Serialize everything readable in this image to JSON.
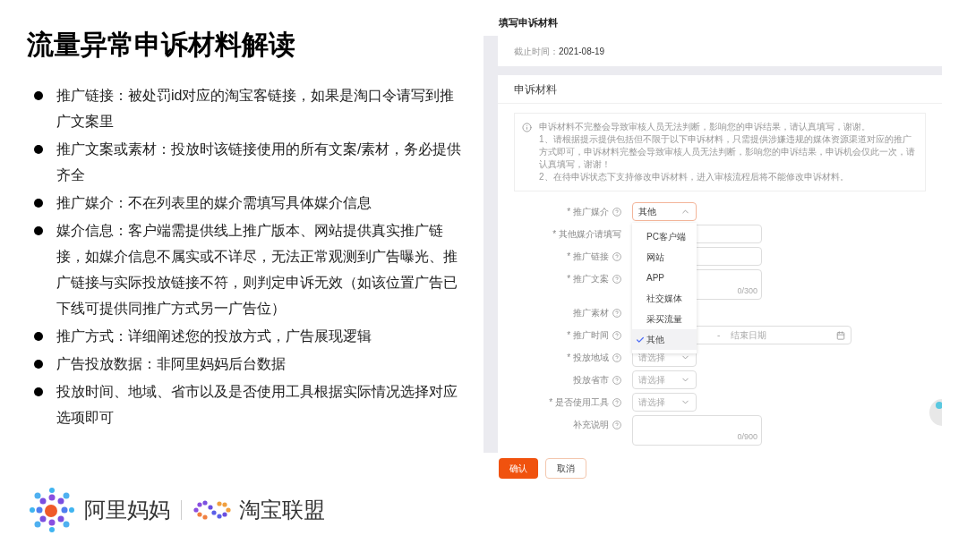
{
  "slide": {
    "title": "流量异常申诉材料解读",
    "bullets": [
      "推广链接：被处罚id对应的淘宝客链接，如果是淘口令请写到推广文案里",
      "推广文案或素材：投放时该链接使用的所有文案/素材，务必提供齐全",
      "推广媒介：不在列表里的媒介需填写具体媒介信息",
      "媒介信息：客户端需提供线上推广版本、网站提供真实推广链接，如媒介信息不属实或不详尽，无法正常观测到广告曝光、推广链接与实际投放链接不符，则判定申诉无效（如该位置广告已下线可提供同推广方式另一广告位）",
      "推广方式：详细阐述您的投放方式，广告展现逻辑",
      "广告投放数据：非阿里妈妈后台数据",
      "投放时间、地域、省市以及是否使用工具根据实际情况选择对应选项即可"
    ],
    "logos": [
      "阿里妈妈",
      "淘宝联盟"
    ]
  },
  "form_page": {
    "title": "填写申诉材料",
    "deadline": {
      "label": "截止时间：",
      "value": "2021-08-19"
    },
    "section_title": "申诉材料",
    "notice": [
      "申诉材料不完整会导致审核人员无法判断，影响您的申诉结果，请认真填写，谢谢。",
      "1、请根据提示提供包括但不限于以下申诉材料，只需提供涉嫌违规的媒体资源渠道对应的推广方式即可，申诉材料完整会导致审核人员无法判断，影响您的申诉结果，申诉机会仅此一次，请认真填写，谢谢！",
      "2、在待申诉状态下支持修改申诉材料，进入审核流程后将不能修改申诉材料。"
    ],
    "fields": [
      {
        "kind": "select",
        "label": "* 推广媒介",
        "help": true,
        "value": "其他",
        "expanded": true,
        "options": [
          {
            "label": "PC客户端",
            "selected": false
          },
          {
            "label": "网站",
            "selected": false
          },
          {
            "label": "APP",
            "selected": false
          },
          {
            "label": "社交媒体",
            "selected": false
          },
          {
            "label": "采买流量",
            "selected": false
          },
          {
            "label": "其他",
            "selected": true
          }
        ]
      },
      {
        "kind": "input",
        "label": "* 其他媒介请填写",
        "help": false
      },
      {
        "kind": "input",
        "label": "* 推广链接",
        "help": true
      },
      {
        "kind": "textarea",
        "label": "* 推广文案",
        "help": true,
        "counter": "0/300"
      },
      {
        "kind": "label",
        "label": "推广素材",
        "help": true
      },
      {
        "kind": "daterange",
        "label": "* 推广时间",
        "help": true,
        "separator": "-",
        "end_placeholder": "结束日期"
      },
      {
        "kind": "select",
        "label": "* 投放地域",
        "help": true,
        "placeholder": "请选择",
        "expanded": false
      },
      {
        "kind": "select",
        "label": "投放省市",
        "help": true,
        "placeholder": "请选择",
        "expanded": false
      },
      {
        "kind": "select",
        "label": "* 是否使用工具",
        "help": true,
        "placeholder": "请选择",
        "expanded": false
      },
      {
        "kind": "textarea",
        "label": "补充说明",
        "help": true,
        "counter": "0/900"
      }
    ],
    "buttons": [
      {
        "label": "确认",
        "primary": true
      },
      {
        "label": "取消",
        "primary": false
      }
    ]
  }
}
